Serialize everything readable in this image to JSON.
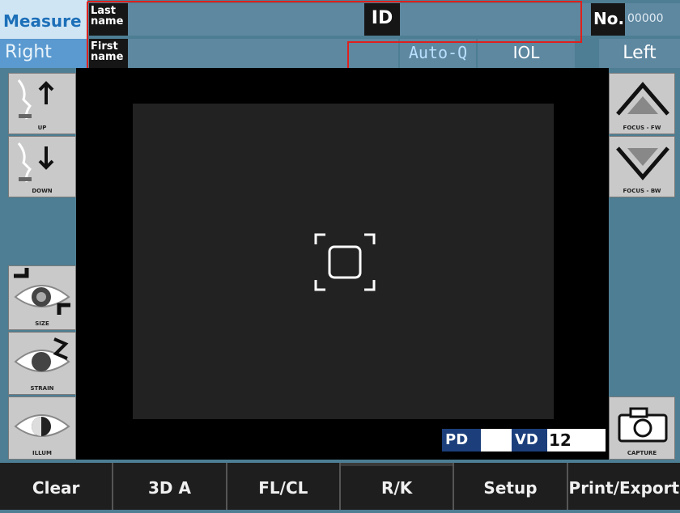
{
  "header": {
    "measure_label": "Measure",
    "side_current": "Right",
    "last_name_label": "Last\nname",
    "first_name_label": "First\nname",
    "id_label": "ID",
    "no_label": "No.",
    "no_value": "00000",
    "auto_q_label": "Auto-Q",
    "iol_label": "IOL",
    "side_other": "Left"
  },
  "left_tools": [
    {
      "caption": "UP",
      "icon": "chin-up-icon"
    },
    {
      "caption": "DOWN",
      "icon": "chin-down-icon"
    },
    {
      "caption": "SIZE",
      "icon": "eye-size-icon"
    },
    {
      "caption": "STRAIN",
      "icon": "eye-strain-icon"
    },
    {
      "caption": "ILLUM",
      "icon": "eye-illum-icon"
    }
  ],
  "right_tools": [
    {
      "caption": "FOCUS - FW",
      "icon": "focus-forward-icon"
    },
    {
      "caption": "FOCUS - BW",
      "icon": "focus-backward-icon"
    },
    {
      "caption": "CAPTURE",
      "icon": "camera-icon"
    }
  ],
  "readouts": {
    "pd_label": "PD",
    "pd_value": "",
    "vd_label": "VD",
    "vd_value": "12"
  },
  "bottom_bar": [
    "Clear",
    "3D A",
    "FL/CL",
    "R/K",
    "Setup",
    "Print/Export"
  ],
  "colors": {
    "accent_red": "#e0201c",
    "panel_blue": "#4d7e93",
    "badge_blue": "#1c3f7c"
  }
}
